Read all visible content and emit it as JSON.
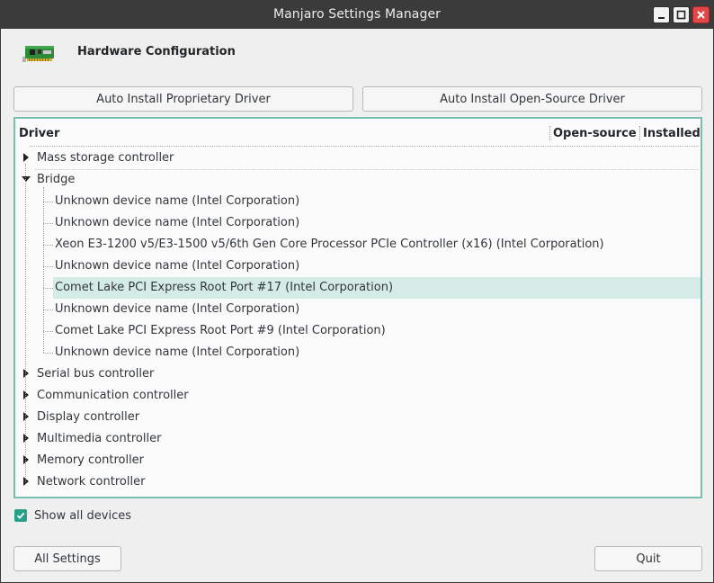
{
  "window": {
    "title": "Manjaro Settings Manager",
    "controls": [
      "minimize-icon",
      "maximize-icon",
      "close-icon"
    ]
  },
  "header": {
    "icon": "hardware-card-icon",
    "title": "Hardware Configuration"
  },
  "actions": {
    "auto_proprietary": "Auto Install Proprietary Driver",
    "auto_opensource": "Auto Install Open-Source Driver"
  },
  "tree": {
    "columns": [
      "Driver",
      "Open-source",
      "Installed"
    ],
    "rows": [
      {
        "label": "Mass storage controller",
        "level": 0,
        "expanded": false
      },
      {
        "label": "Bridge",
        "level": 0,
        "expanded": true
      },
      {
        "label": "Unknown device name (Intel Corporation)",
        "level": 1
      },
      {
        "label": "Unknown device name (Intel Corporation)",
        "level": 1
      },
      {
        "label": "Xeon E3-1200 v5/E3-1500 v5/6th Gen Core Processor PCIe Controller (x16) (Intel Corporation)",
        "level": 1
      },
      {
        "label": "Unknown device name (Intel Corporation)",
        "level": 1
      },
      {
        "label": "Comet Lake PCI Express Root Port #17 (Intel Corporation)",
        "level": 1,
        "selected": true
      },
      {
        "label": "Unknown device name (Intel Corporation)",
        "level": 1
      },
      {
        "label": "Comet Lake PCI Express Root Port #9 (Intel Corporation)",
        "level": 1
      },
      {
        "label": "Unknown device name (Intel Corporation)",
        "level": 1
      },
      {
        "label": "Serial bus controller",
        "level": 0,
        "expanded": false
      },
      {
        "label": "Communication controller",
        "level": 0,
        "expanded": false
      },
      {
        "label": "Display controller",
        "level": 0,
        "expanded": false
      },
      {
        "label": "Multimedia controller",
        "level": 0,
        "expanded": false
      },
      {
        "label": "Memory controller",
        "level": 0,
        "expanded": false
      },
      {
        "label": "Network controller",
        "level": 0,
        "expanded": false
      }
    ]
  },
  "options": {
    "show_all_devices": "Show all devices",
    "show_all_checked": true
  },
  "footer": {
    "all_settings": "All Settings",
    "quit": "Quit"
  },
  "colors": {
    "accent": "#78c0ad",
    "selection": "#d5ece6",
    "check": "#2aa08a",
    "titlebar": "#3b3b3b",
    "close": "#e24848"
  }
}
